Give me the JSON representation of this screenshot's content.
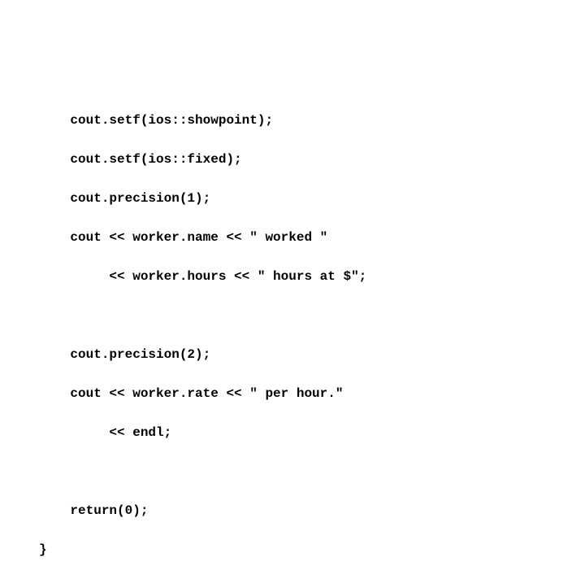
{
  "code": {
    "line1": "    cout.setf(ios::showpoint);",
    "line2": "    cout.setf(ios::fixed);",
    "line3": "    cout.precision(1);",
    "line4": "    cout << worker.name << \" worked \"",
    "line5": "         << worker.hours << \" hours at $\";",
    "line6": "    cout.precision(2);",
    "line7": "    cout << worker.rate << \" per hour.\"",
    "line8": "         << endl;",
    "line9": "    return(0);",
    "line10": "}"
  }
}
